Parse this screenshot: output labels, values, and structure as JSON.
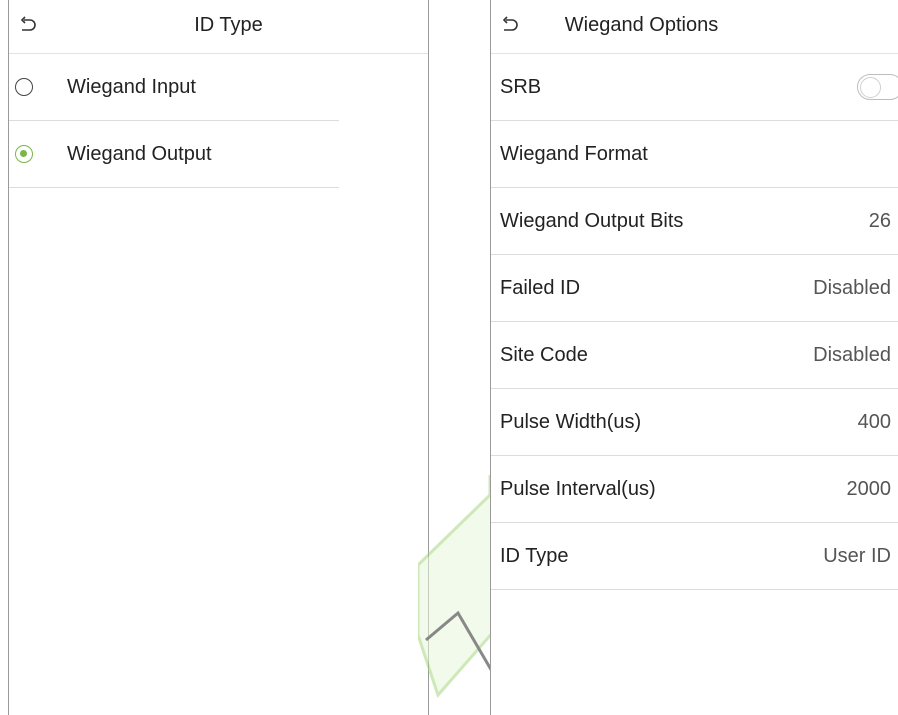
{
  "left": {
    "title": "ID Type",
    "options": [
      {
        "label": "Wiegand Input",
        "selected": false
      },
      {
        "label": "Wiegand Output",
        "selected": true
      }
    ]
  },
  "right": {
    "title": "Wiegand Options",
    "srb": {
      "label": "SRB",
      "enabled": false
    },
    "rows": [
      {
        "label": "Wiegand Format",
        "value": ""
      },
      {
        "label": "Wiegand Output Bits",
        "value": "26"
      },
      {
        "label": "Failed ID",
        "value": "Disabled"
      },
      {
        "label": "Site Code",
        "value": "Disabled"
      },
      {
        "label": "Pulse Width(us)",
        "value": "400"
      },
      {
        "label": "Pulse Interval(us)",
        "value": "2000"
      },
      {
        "label": "ID Type",
        "value": "User ID"
      }
    ]
  },
  "colors": {
    "accent": "#7ab648",
    "arrow": "#d7f0c2"
  }
}
